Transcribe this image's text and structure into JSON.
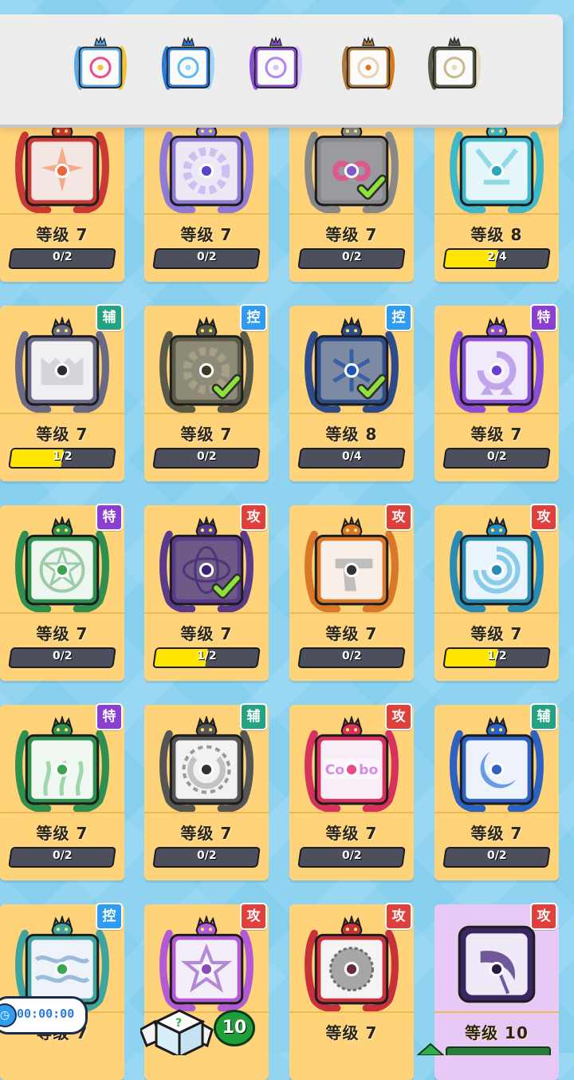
{
  "filters": [
    {
      "name": "rainbow-infinity-filter",
      "primary": "#5aa9e6",
      "secondary": "#e84d8a",
      "accent": "#f4c430"
    },
    {
      "name": "snowflake-filter",
      "primary": "#2e7ad9",
      "secondary": "#5fb8f5",
      "accent": "#9fd6ff"
    },
    {
      "name": "purple-orbit-filter",
      "primary": "#8a4fd6",
      "secondary": "#b484ef",
      "accent": "#d9c2f7"
    },
    {
      "name": "mystery-question-filter",
      "primary": "#b07a3d",
      "secondary": "#e8d4b4",
      "accent": "#d97a1a"
    },
    {
      "name": "gold-cog-filter",
      "primary": "#5a5a48",
      "secondary": "#c9b98d",
      "accent": "#e6dcbe"
    }
  ],
  "level_prefix": "等级",
  "tags": {
    "support": {
      "label": "辅",
      "color": "#24a383"
    },
    "control": {
      "label": "控",
      "color": "#2e9cf0"
    },
    "special": {
      "label": "特",
      "color": "#8a3fd1"
    },
    "attack": {
      "label": "攻",
      "color": "#e0403b"
    }
  },
  "cards": [
    {
      "level": "7",
      "progress": "0/2",
      "fill": 0,
      "tag": null,
      "owned": false,
      "dragon": "#c83a33",
      "face": "#f4e7e3",
      "dot": "#e8663a",
      "icon": "star-burst-icon"
    },
    {
      "level": "7",
      "progress": "0/2",
      "fill": 0,
      "tag": null,
      "owned": false,
      "dragon": "#8f7ad6",
      "face": "#ece8f6",
      "dot": "#5b42c7",
      "icon": "gear-icon"
    },
    {
      "level": "7",
      "progress": "0/2",
      "fill": 0,
      "tag": null,
      "owned": true,
      "dragon": "#888",
      "face": "#9a9aa0",
      "dot": "#7a5cc9",
      "icon": "rainbow-infinity-icon"
    },
    {
      "level": "8",
      "progress": "2/4",
      "fill": 0.5,
      "tag": null,
      "owned": false,
      "dragon": "#3fb8c9",
      "face": "#e6f6f8",
      "dot": "#2aa8b6",
      "icon": "frost-crest-icon"
    },
    {
      "level": "7",
      "progress": "1/2",
      "fill": 0.5,
      "tag": "support",
      "owned": false,
      "dragon": "#6a6a86",
      "face": "#f0f0f3",
      "dot": "#2b2b2b",
      "icon": "jaws-icon"
    },
    {
      "level": "7",
      "progress": "0/2",
      "fill": 0,
      "tag": "control",
      "owned": true,
      "dragon": "#5a5a48",
      "face": "#8d8a78",
      "dot": "#3a3b25",
      "icon": "gold-cog-icon"
    },
    {
      "level": "8",
      "progress": "0/4",
      "fill": 0,
      "tag": "control",
      "owned": true,
      "dragon": "#2e4c8a",
      "face": "#7d8aa3",
      "dot": "#1f56b5",
      "icon": "snowflake-icon"
    },
    {
      "level": "7",
      "progress": "0/2",
      "fill": 0,
      "tag": "special",
      "owned": false,
      "dragon": "#8a4fd6",
      "face": "#f1eafb",
      "dot": "#6a3fd1",
      "icon": "spiral-arrows-icon"
    },
    {
      "level": "7",
      "progress": "0/2",
      "fill": 0,
      "tag": "special",
      "owned": false,
      "dragon": "#2f8f4e",
      "face": "#eef6f0",
      "dot": "#39a64f",
      "icon": "pentagram-icon"
    },
    {
      "level": "7",
      "progress": "1/2",
      "fill": 0.5,
      "tag": "attack",
      "owned": true,
      "dragon": "#5a3a8a",
      "face": "#6e5a86",
      "dot": "#3d1f73",
      "icon": "purple-orbit-icon"
    },
    {
      "level": "7",
      "progress": "0/2",
      "fill": 0,
      "tag": "attack",
      "owned": false,
      "dragon": "#d9782a",
      "face": "#f7efe8",
      "dot": "#333",
      "icon": "pistol-icon"
    },
    {
      "level": "7",
      "progress": "1/2",
      "fill": 0.5,
      "tag": "attack",
      "owned": false,
      "dragon": "#2a8cb5",
      "face": "#eaf5fb",
      "dot": "#2a8cb5",
      "icon": "vortex-icon"
    },
    {
      "level": "7",
      "progress": "0/2",
      "fill": 0,
      "tag": "special",
      "owned": false,
      "dragon": "#2f8f4e",
      "face": "#f1f8f2",
      "dot": "#39a64f",
      "icon": "seaweed-icon"
    },
    {
      "level": "7",
      "progress": "0/2",
      "fill": 0,
      "tag": "support",
      "owned": false,
      "dragon": "#555",
      "face": "#f2f2f2",
      "dot": "#333",
      "icon": "dashed-circle-icon"
    },
    {
      "level": "7",
      "progress": "0/2",
      "fill": 0,
      "tag": "attack",
      "owned": false,
      "dragon": "#d8315b",
      "face": "#f7eef7",
      "dot": "#e84d8a",
      "icon": "combo-icon",
      "label": "Combo"
    },
    {
      "level": "7",
      "progress": "0/2",
      "fill": 0,
      "tag": "support",
      "owned": false,
      "dragon": "#2e62c2",
      "face": "#edf2fb",
      "dot": "#2e62c2",
      "icon": "crescent-moon-icon"
    },
    {
      "level": "7",
      "progress": "",
      "fill": 0,
      "tag": "control",
      "owned": false,
      "dragon": "#3fa3a0",
      "face": "#eef3fa",
      "dot": "#39a64f",
      "icon": "wave-icon"
    },
    {
      "level": "",
      "progress": "",
      "fill": 0,
      "tag": "attack",
      "owned": false,
      "dragon": "#b35ad6",
      "face": "#f4eefa",
      "dot": "#8b4ab8",
      "icon": "star-icon"
    },
    {
      "level": "7",
      "progress": "",
      "fill": 0,
      "tag": "attack",
      "owned": false,
      "dragon": "#c8303a",
      "face": "#f4f4f4",
      "dot": "#6b2a3a",
      "icon": "sawblade-icon"
    },
    {
      "level": "10",
      "progress": "",
      "fill": 0,
      "tag": "attack",
      "owned": false,
      "dragon": "#2a1a4a",
      "face": "#efe9f8",
      "dot": "#2a1a4a",
      "icon": "scythe-icon",
      "purple": true
    }
  ],
  "timer": "00:00:00",
  "dice_count": "10"
}
